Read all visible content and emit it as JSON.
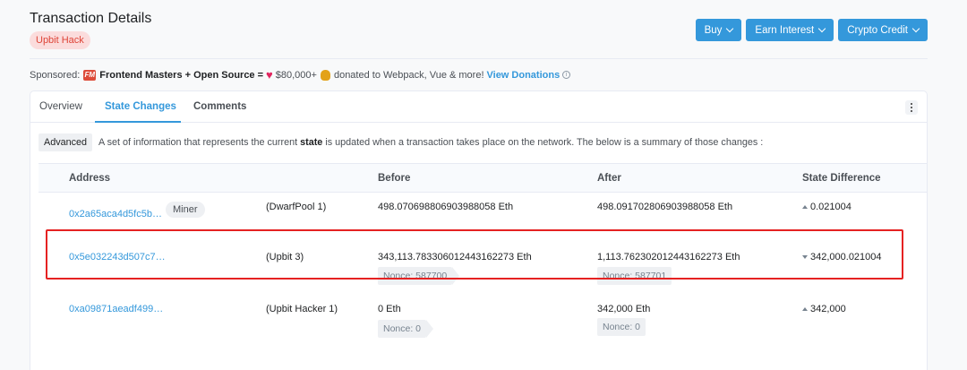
{
  "header": {
    "title": "Transaction Details",
    "tag": "Upbit Hack",
    "buttons": [
      {
        "label": "Buy"
      },
      {
        "label": "Earn Interest"
      },
      {
        "label": "Crypto Credit"
      }
    ]
  },
  "sponsor": {
    "prefix": "Sponsored:",
    "brand_icon_text": "FM",
    "name": "Frontend Masters + Open Source =",
    "amount": "$80,000+",
    "text": "donated to Webpack, Vue & more!",
    "link": "View Donations",
    "info_icon_text": "i"
  },
  "tabs": [
    {
      "label": "Overview"
    },
    {
      "label": "State Changes"
    },
    {
      "label": "Comments"
    }
  ],
  "advanced": {
    "badge": "Advanced",
    "text_before": "A set of information that represents the current",
    "text_bold": "state",
    "text_after": "is updated when a transaction takes place on the network. The below is a summary of those changes :"
  },
  "table": {
    "headers": [
      "Address",
      "Before",
      "After",
      "State Difference"
    ],
    "rows": [
      {
        "address": "0x2a65aca4d5fc5b…",
        "badge": "Miner",
        "label": "(DwarfPool 1)",
        "before": "498.070698806903988058 Eth",
        "after": "498.091702806903988058 Eth",
        "diff": "0.021004",
        "diff_dir": "up"
      },
      {
        "address": "0x5e032243d507c7…",
        "label": "(Upbit 3)",
        "before": "343,113.783306012443162273 Eth",
        "before_nonce": "Nonce: 587700",
        "after": "1,113.762302012443162273 Eth",
        "after_nonce": "Nonce: 587701",
        "diff": "342,000.021004",
        "diff_dir": "down"
      },
      {
        "address": "0xa09871aeadf499…",
        "label": "(Upbit Hacker 1)",
        "before": "0 Eth",
        "before_nonce": "Nonce: 0",
        "after": "342,000 Eth",
        "after_nonce": "Nonce: 0",
        "diff": "342,000",
        "diff_dir": "up"
      }
    ]
  },
  "colors": {
    "accent": "#3498db",
    "highlight": "#e52222"
  }
}
